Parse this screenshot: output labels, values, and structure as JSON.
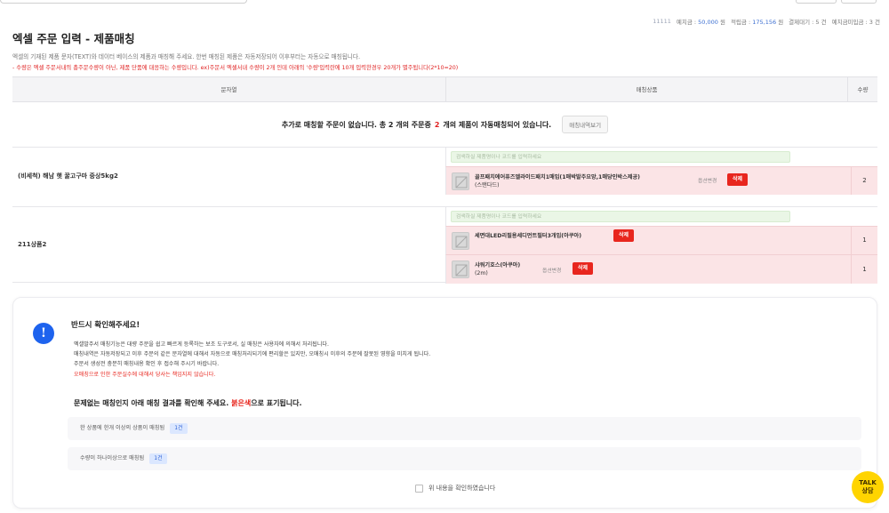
{
  "topbar": {
    "search_placeholder": "",
    "caret": "▾"
  },
  "account": {
    "id": "11111",
    "deposit_label": "예치금 : ",
    "deposit_value": "50,000",
    "deposit_unit": " 원",
    "points_label": "적립금 : ",
    "points_value": "175,156",
    "points_unit": " 원",
    "pending_payment": "결제대기 : 5 건",
    "deposit_unpaid": "예치금미입금 : 3 건"
  },
  "page": {
    "title": "엑셀 주문 입력 - 제품매칭",
    "desc_line1": "엑셀의 기재된 제품 문자(TEXT)와 데이터 베이스의 제품과 매칭해 주세요. 한번 매칭된 제품은 자동저장되어 이후부터는 자동으로 매칭됩니다.",
    "desc_line2": "- 수량은 엑셀 주문서내의 총주문수량이 아닌, 제품 단품에 대응하는 수량입니다. ex)주문서 엑셀서내 수량이 2개 인데 아래의 '수량'입력란에 10개 입력한경우 20개가 별주됩니다(2*10=20)"
  },
  "table": {
    "headers": {
      "text": "문자열",
      "product": "매칭상품",
      "qty": "수량"
    },
    "notice_prefix": "추가로 매칭할 주문이 없습니다. 총 2 개의 주문중",
    "notice_count": "2",
    "notice_suffix": "개의 제품이 자동매칭되어 있습니다.",
    "history_button": "매칭내역보기",
    "search_placeholder": "검색하실 제품명이나 코드를 입력하세요",
    "option_change": "옵션변경",
    "delete": "삭제",
    "groups": [
      {
        "name": "(비세척) 해남 햇 꿀고구마 중상5kg2",
        "items": [
          {
            "name_bold": "골프패치에어퓨즈엘라이드패치1매입(1매박발주요망,1매당인박스제공)",
            "name_rest": "(스탠다드)",
            "has_option": true,
            "qty": "2"
          }
        ]
      },
      {
        "name": "211상품2",
        "items": [
          {
            "name_bold": "세면대LED리필용세디먼트필터3개입(아쿠아)",
            "name_rest": "",
            "has_option": false,
            "qty": "1"
          },
          {
            "name_bold": "샤워기호스(아쿠아)",
            "name_rest": "(2m)",
            "has_option": true,
            "qty": "1"
          }
        ]
      }
    ]
  },
  "card": {
    "icon": "!",
    "title": "반드시 확인해주세요!",
    "lines": [
      "엑셀발주서 매칭기능은 대량 주문을 쉽고 빠르게 등록하는 보조 도구로서, 실 매칭은 사용자에 의해서 처리됩니다.",
      "매칭내역은 자동저장되고 이후 주문의 같은 문자열에 대해서 자동으로 매칭처리되기에 편리할은 있지만, 오매칭시 이후의 주문에 잘못된 영향을 미치게 됩니다.",
      "주문서 생성전 충분히 매칭내용 확인 후 접수해 주시기 바랍니다."
    ],
    "warning": "오매칭으로 인한 주문실수에 대해서 당사는 책임지지 않습니다.",
    "sub_prefix": "문제없는 매칭인지 아래 매칭 결과를 확인해 주세요.",
    "sub_red": "붉은색",
    "sub_suffix": "으로 표기됩니다.",
    "summary": [
      {
        "label": "한 상품에 한개 이상의 상품이 매칭됨",
        "badge": "1건"
      },
      {
        "label": "수량이 하나이상으로 매칭됨",
        "badge": "1건"
      }
    ],
    "confirm_label": "위 내용을 확인하였습니다"
  },
  "talk": {
    "line1": "TALK",
    "line2": "상담"
  }
}
